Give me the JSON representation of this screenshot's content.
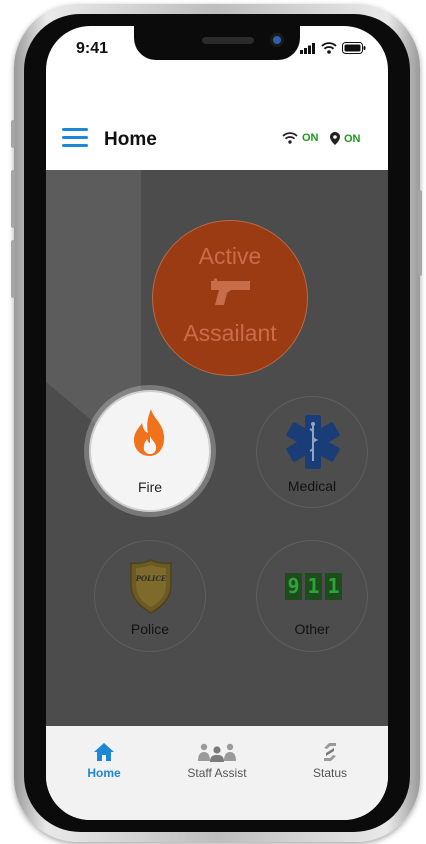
{
  "status_bar": {
    "time": "9:41"
  },
  "header": {
    "title": "Home",
    "wifi_status": "ON",
    "location_status": "ON"
  },
  "emergencies": {
    "active_assailant": {
      "line1": "Active",
      "line2": "Assailant"
    },
    "fire": {
      "label": "Fire"
    },
    "medical": {
      "label": "Medical"
    },
    "police": {
      "label": "Police",
      "badge_text": "POLICE"
    },
    "other": {
      "label": "Other",
      "digits": [
        "9",
        "1",
        "1"
      ]
    }
  },
  "bottom_nav": {
    "items": [
      {
        "label": "Home",
        "icon": "home-icon",
        "active": true
      },
      {
        "label": "Staff Assist",
        "icon": "staff-group-icon",
        "active": false
      },
      {
        "label": "Status",
        "icon": "status-icon",
        "active": false
      }
    ]
  },
  "colors": {
    "accent": "#1d87d6",
    "on_green": "#1a9b1a",
    "fire_orange": "#f0731c",
    "assailant_red": "#9b3b14"
  }
}
